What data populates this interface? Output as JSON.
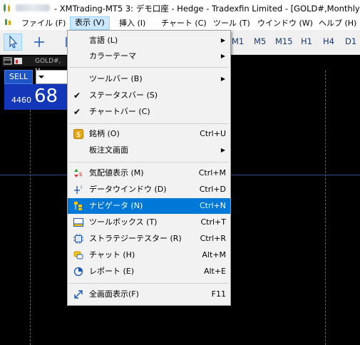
{
  "window": {
    "title": "- XMTrading-MT5 3: デモ口座 - Hedge - Tradexfin Limited - [GOLD#,Monthly]"
  },
  "menubar": {
    "items": [
      "ファイル (F)",
      "表示 (V)",
      "挿入 (I)",
      "チャート (C)",
      "ツール (T)",
      "ウインドウ (W)",
      "ヘルプ (H)"
    ],
    "active": "表示 (V)"
  },
  "toolbar": {
    "timeframes": [
      "M1",
      "M5",
      "M15",
      "H1",
      "H4",
      "D1"
    ]
  },
  "chart": {
    "tab_label": "GOLD#, M",
    "sell_label": "SELL",
    "price_prefix": "4460",
    "price_big": "68"
  },
  "view_menu": {
    "items": [
      {
        "label": "言語 (L)",
        "shortcut": "",
        "submenu": true,
        "checked": false,
        "icon": ""
      },
      {
        "label": "カラーテーマ",
        "shortcut": "",
        "submenu": true,
        "checked": false,
        "icon": ""
      },
      {
        "label": "ツールバー (B)",
        "shortcut": "",
        "submenu": true,
        "checked": false,
        "icon": ""
      },
      {
        "label": "ステータスバー (S)",
        "shortcut": "",
        "submenu": false,
        "checked": true,
        "icon": ""
      },
      {
        "label": "チャートバー (C)",
        "shortcut": "",
        "submenu": false,
        "checked": true,
        "icon": ""
      },
      {
        "label": "銘柄 (O)",
        "shortcut": "Ctrl+U",
        "submenu": false,
        "checked": false,
        "icon": "symbols-icon"
      },
      {
        "label": "板注文画面",
        "shortcut": "",
        "submenu": true,
        "checked": false,
        "icon": ""
      },
      {
        "label": "気配値表示 (M)",
        "shortcut": "Ctrl+M",
        "submenu": false,
        "checked": false,
        "icon": "market-watch-icon"
      },
      {
        "label": "データウインドウ (D)",
        "shortcut": "Ctrl+D",
        "submenu": false,
        "checked": false,
        "icon": "data-window-icon"
      },
      {
        "label": "ナビゲータ (N)",
        "shortcut": "Ctrl+N",
        "submenu": false,
        "checked": false,
        "icon": "navigator-icon",
        "highlighted": true
      },
      {
        "label": "ツールボックス (T)",
        "shortcut": "Ctrl+T",
        "submenu": false,
        "checked": false,
        "icon": "toolbox-icon"
      },
      {
        "label": "ストラテジーテスター (R)",
        "shortcut": "Ctrl+R",
        "submenu": false,
        "checked": false,
        "icon": "strategy-tester-icon"
      },
      {
        "label": "チャット (H)",
        "shortcut": "Alt+M",
        "submenu": false,
        "checked": false,
        "icon": "chat-icon"
      },
      {
        "label": "レポート (E)",
        "shortcut": "Alt+E",
        "submenu": false,
        "checked": false,
        "icon": "report-icon"
      },
      {
        "label": "全画面表示(F)",
        "shortcut": "F11",
        "submenu": false,
        "checked": false,
        "icon": "fullscreen-icon"
      }
    ]
  },
  "colors": {
    "highlight": "#0078d7",
    "menubar_active": "#cce8ff",
    "sell_button": "#1f56c7",
    "price_box": "#1436b8"
  }
}
